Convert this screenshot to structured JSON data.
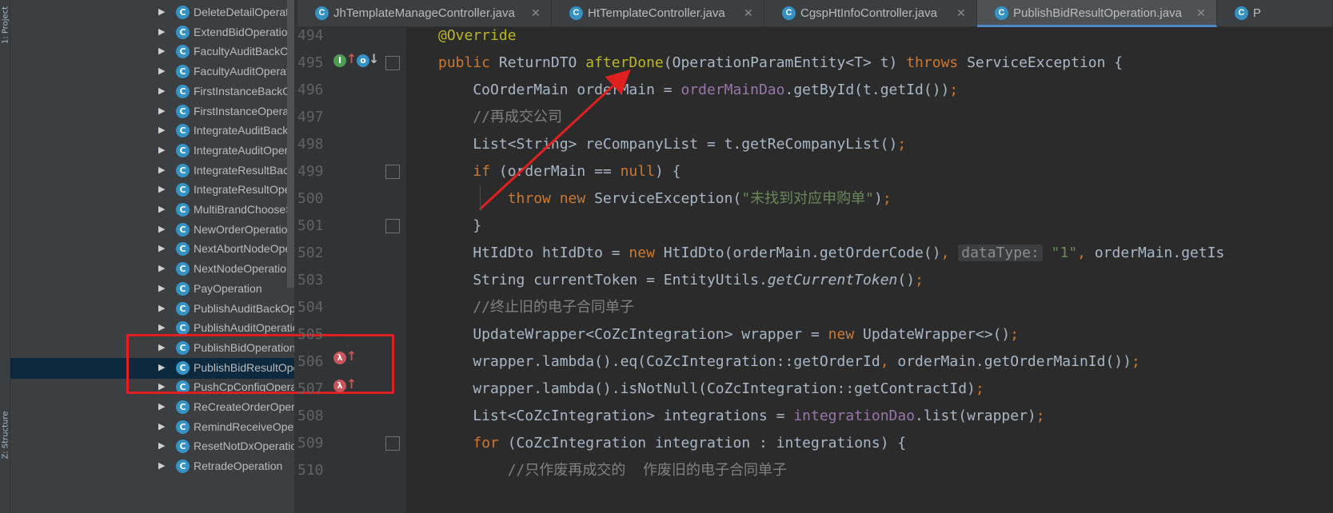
{
  "sidebar": {
    "tool_windows": [
      "1: Project",
      "Z: Structure"
    ],
    "tree_items": [
      {
        "label": "DeleteDetailOperation",
        "icon": "class-icon"
      },
      {
        "label": "ExtendBidOperation",
        "icon": "class-icon"
      },
      {
        "label": "FacultyAuditBackOperation",
        "icon": "class-icon"
      },
      {
        "label": "FacultyAuditOperation",
        "icon": "class-icon"
      },
      {
        "label": "FirstInstanceBackOperation",
        "icon": "class-icon"
      },
      {
        "label": "FirstInstanceOperation",
        "icon": "class-icon"
      },
      {
        "label": "IntegrateAuditBackOperation",
        "icon": "class-icon"
      },
      {
        "label": "IntegrateAuditOperation",
        "icon": "class-icon"
      },
      {
        "label": "IntegrateResultBackOperation",
        "icon": "class-icon"
      },
      {
        "label": "IntegrateResultOperation",
        "icon": "class-icon"
      },
      {
        "label": "MultiBrandChooseSupplierOperation",
        "icon": "class-icon"
      },
      {
        "label": "NewOrderOperation",
        "icon": "class-icon"
      },
      {
        "label": "NextAbortNodeOperation",
        "icon": "class-icon"
      },
      {
        "label": "NextNodeOperation",
        "icon": "class-icon"
      },
      {
        "label": "PayOperation",
        "icon": "class-icon"
      },
      {
        "label": "PublishAuditBackOperation",
        "icon": "class-icon"
      },
      {
        "label": "PublishAuditOperation",
        "icon": "class-icon"
      },
      {
        "label": "PublishBidOperation",
        "icon": "class-icon"
      },
      {
        "label": "PublishBidResultOperation",
        "icon": "class-icon",
        "selected": true
      },
      {
        "label": "PushCpConfigOperation",
        "icon": "class-icon"
      },
      {
        "label": "ReCreateOrderOperation",
        "icon": "class-icon"
      },
      {
        "label": "RemindReceiveOperation",
        "icon": "class-icon"
      },
      {
        "label": "ResetNotDxOperation",
        "icon": "class-icon"
      },
      {
        "label": "RetradeOperation",
        "icon": "class-icon"
      }
    ]
  },
  "tabs": [
    {
      "label": "JhTemplateManageController.java",
      "active": false
    },
    {
      "label": "HtTemplateController.java",
      "active": false
    },
    {
      "label": "CgspHtInfoController.java",
      "active": false
    },
    {
      "label": "PublishBidResultOperation.java",
      "active": true
    },
    {
      "label": "P",
      "active": false
    }
  ],
  "editor": {
    "line_numbers": [
      "494",
      "495",
      "496",
      "497",
      "498",
      "499",
      "500",
      "501",
      "502",
      "503",
      "504",
      "505",
      "506",
      "507",
      "508",
      "509",
      "510"
    ],
    "lines": [
      [
        {
          "t": "@Override",
          "c": "ann"
        }
      ],
      [
        {
          "t": "public ",
          "c": "kw"
        },
        {
          "t": "ReturnDTO "
        },
        {
          "t": "afterDone",
          "c": "ann"
        },
        {
          "t": "(OperationParamEntity<T> t) "
        },
        {
          "t": "throws ",
          "c": "kw"
        },
        {
          "t": "ServiceException {"
        }
      ],
      [
        {
          "t": "    CoOrderMain orderMain = "
        },
        {
          "t": "orderMainDao",
          "c": "fld"
        },
        {
          "t": ".getById(t.getId())"
        },
        {
          "t": ";",
          "c": "kw"
        }
      ],
      [
        {
          "t": "    //再成交公司",
          "c": "cmt"
        }
      ],
      [
        {
          "t": "    List<String> reCompanyList = t.getReCompanyList()"
        },
        {
          "t": ";",
          "c": "kw"
        }
      ],
      [
        {
          "t": "    "
        },
        {
          "t": "if ",
          "c": "kw"
        },
        {
          "t": "(orderMain == "
        },
        {
          "t": "null",
          "c": "kw"
        },
        {
          "t": ") {"
        }
      ],
      [
        {
          "t": "        "
        },
        {
          "t": "throw new ",
          "c": "kw"
        },
        {
          "t": "ServiceException("
        },
        {
          "t": "\"未找到对应申购单\"",
          "c": "str"
        },
        {
          "t": ")"
        },
        {
          "t": ";",
          "c": "kw"
        }
      ],
      [
        {
          "t": "    }"
        }
      ],
      [
        {
          "t": "    HtIdDto htIdDto = "
        },
        {
          "t": "new ",
          "c": "kw"
        },
        {
          "t": "HtIdDto(orderMain.getOrderCode()"
        },
        {
          "t": ", ",
          "c": "kw"
        },
        {
          "t": "dataType:",
          "c": "hint"
        },
        {
          "t": " "
        },
        {
          "t": "\"1\"",
          "c": "str"
        },
        {
          "t": ", ",
          "c": "kw"
        },
        {
          "t": "orderMain.getIs"
        }
      ],
      [
        {
          "t": "    String currentToken = EntityUtils."
        },
        {
          "t": "getCurrentToken",
          "c": "itl"
        },
        {
          "t": "()"
        },
        {
          "t": ";",
          "c": "kw"
        }
      ],
      [
        {
          "t": "    //终止旧的电子合同单子",
          "c": "cmt"
        }
      ],
      [
        {
          "t": "    UpdateWrapper<CoZcIntegration> wrapper = "
        },
        {
          "t": "new ",
          "c": "kw"
        },
        {
          "t": "UpdateWrapper<>()"
        },
        {
          "t": ";",
          "c": "kw"
        }
      ],
      [
        {
          "t": "    wrapper.lambda().eq(CoZcIntegration::getOrderId"
        },
        {
          "t": ", ",
          "c": "kw"
        },
        {
          "t": "orderMain.getOrderMainId())"
        },
        {
          "t": ";",
          "c": "kw"
        }
      ],
      [
        {
          "t": "    wrapper.lambda().isNotNull(CoZcIntegration::getContractId)"
        },
        {
          "t": ";",
          "c": "kw"
        }
      ],
      [
        {
          "t": "    List<CoZcIntegration> integrations = "
        },
        {
          "t": "integrationDao",
          "c": "fld"
        },
        {
          "t": ".list(wrapper)"
        },
        {
          "t": ";",
          "c": "kw"
        }
      ],
      [
        {
          "t": "    "
        },
        {
          "t": "for ",
          "c": "kw"
        },
        {
          "t": "(CoZcIntegration integration : integrations) {"
        }
      ],
      [
        {
          "t": "        //只作废再成交的  作废旧的电子合同单子",
          "c": "cmt"
        }
      ]
    ]
  },
  "colors": {
    "annotation_box": "#e02020",
    "arrow": "#e02020",
    "keyword": "#cc7832",
    "selected_row": "#0d293e"
  }
}
